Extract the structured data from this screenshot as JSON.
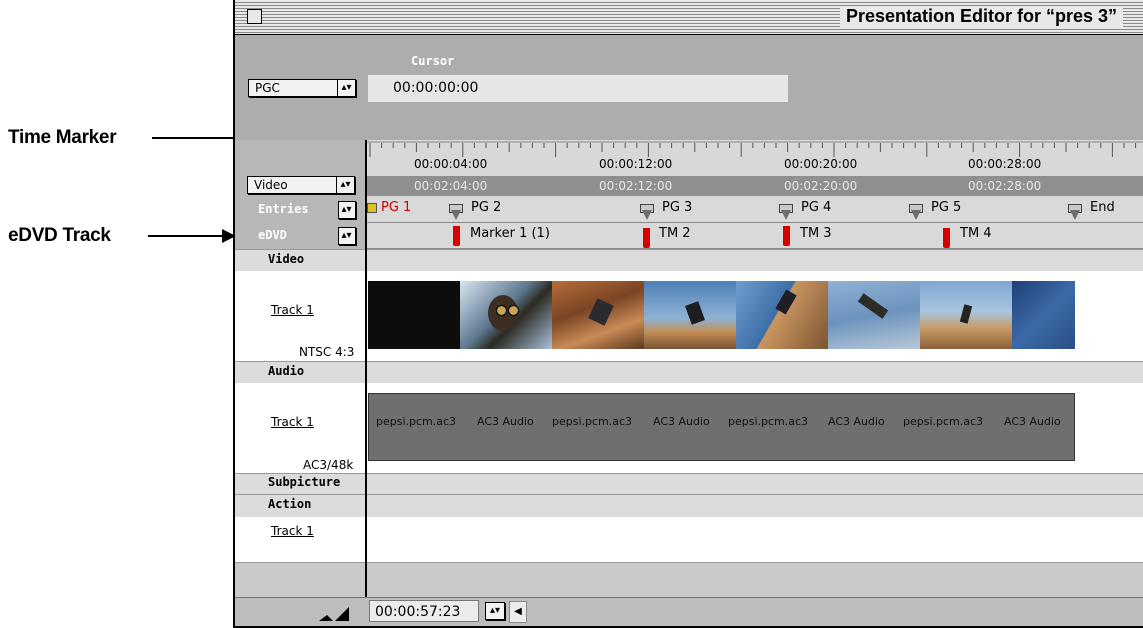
{
  "annotations": {
    "time_marker": "Time Marker",
    "edvd_track": "eDVD Track"
  },
  "window": {
    "title": "Presentation Editor for “pres 3”"
  },
  "top": {
    "pgc_popup": "PGC",
    "cursor_label": "Cursor",
    "cursor_value": "00:00:00:00"
  },
  "ruler": {
    "timecodes_top": [
      "00:00:04:00",
      "00:00:12:00",
      "00:00:20:00",
      "00:00:28:00"
    ],
    "timecodes_bottom": [
      "00:02:04:00",
      "00:02:12:00",
      "00:02:20:00",
      "00:02:28:00"
    ]
  },
  "rows": {
    "video_popup": "Video",
    "entries_label": "Entries",
    "edvd_label": "eDVD"
  },
  "entries": [
    "PG 1",
    "PG 2",
    "PG 3",
    "PG 4",
    "PG 5",
    "End"
  ],
  "edvd_markers": [
    "Marker 1 (1)",
    "TM 2",
    "TM 3",
    "TM 4"
  ],
  "sections": {
    "video": "Video",
    "audio": "Audio",
    "subpicture": "Subpicture",
    "action": "Action"
  },
  "video_track": {
    "name": "Track 1",
    "format": "NTSC 4:3"
  },
  "audio_track": {
    "name": "Track 1",
    "format": "AC3/48k",
    "clips": [
      "pepsi.pcm.ac3",
      "AC3 Audio",
      "pepsi.pcm.ac3",
      "AC3 Audio",
      "pepsi.pcm.ac3",
      "AC3 Audio",
      "pepsi.pcm.ac3",
      "AC3 Audio"
    ]
  },
  "action_track": {
    "name": "Track 1"
  },
  "bottom": {
    "duration": "00:00:57:23"
  },
  "colors": {
    "marker_red": "#d50000",
    "pg1_red": "#cc0000",
    "panel_gray": "#adadad"
  }
}
